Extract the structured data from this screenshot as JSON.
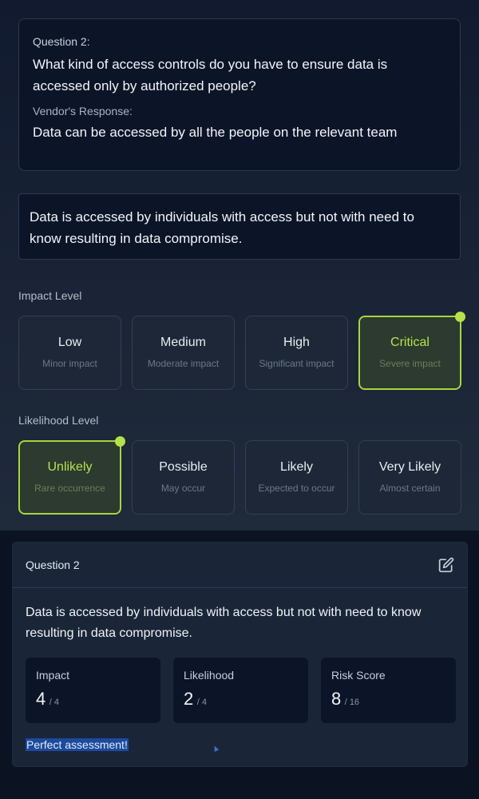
{
  "question": {
    "label": "Question 2:",
    "text": "What kind of access controls do you have to ensure data is accessed only by authorized people?",
    "response_label": "Vendor's Response:",
    "response_text": "Data can be accessed by all the people on the relevant team"
  },
  "rationale": "Data is accessed by individuals with access but not with need to know resulting in data compromise.",
  "impact": {
    "label": "Impact Level",
    "options": [
      {
        "title": "Low",
        "subtitle": "Minor impact",
        "selected": false
      },
      {
        "title": "Medium",
        "subtitle": "Moderate impact",
        "selected": false
      },
      {
        "title": "High",
        "subtitle": "Significant impact",
        "selected": false
      },
      {
        "title": "Critical",
        "subtitle": "Severe impact",
        "selected": true
      }
    ]
  },
  "likelihood": {
    "label": "Likelihood Level",
    "options": [
      {
        "title": "Unlikely",
        "subtitle": "Rare occurrence",
        "selected": true
      },
      {
        "title": "Possible",
        "subtitle": "May occur",
        "selected": false
      },
      {
        "title": "Likely",
        "subtitle": "Expected to occur",
        "selected": false
      },
      {
        "title": "Very Likely",
        "subtitle": "Almost certain",
        "selected": false
      }
    ]
  },
  "summary": {
    "title": "Question 2",
    "text": "Data is accessed by individuals with access but not with need to know resulting in data compromise.",
    "metrics": [
      {
        "label": "Impact",
        "value": "4",
        "max": "/ 4"
      },
      {
        "label": "Likelihood",
        "value": "2",
        "max": "/ 4"
      },
      {
        "label": "Risk Score",
        "value": "8",
        "max": "/ 16"
      }
    ],
    "feedback": "Perfect assessment!"
  },
  "colors": {
    "accent": "#b5e246",
    "card": "#0c1528",
    "highlight": "#1b4a9e"
  },
  "icons": {
    "edit": "edit-icon"
  }
}
